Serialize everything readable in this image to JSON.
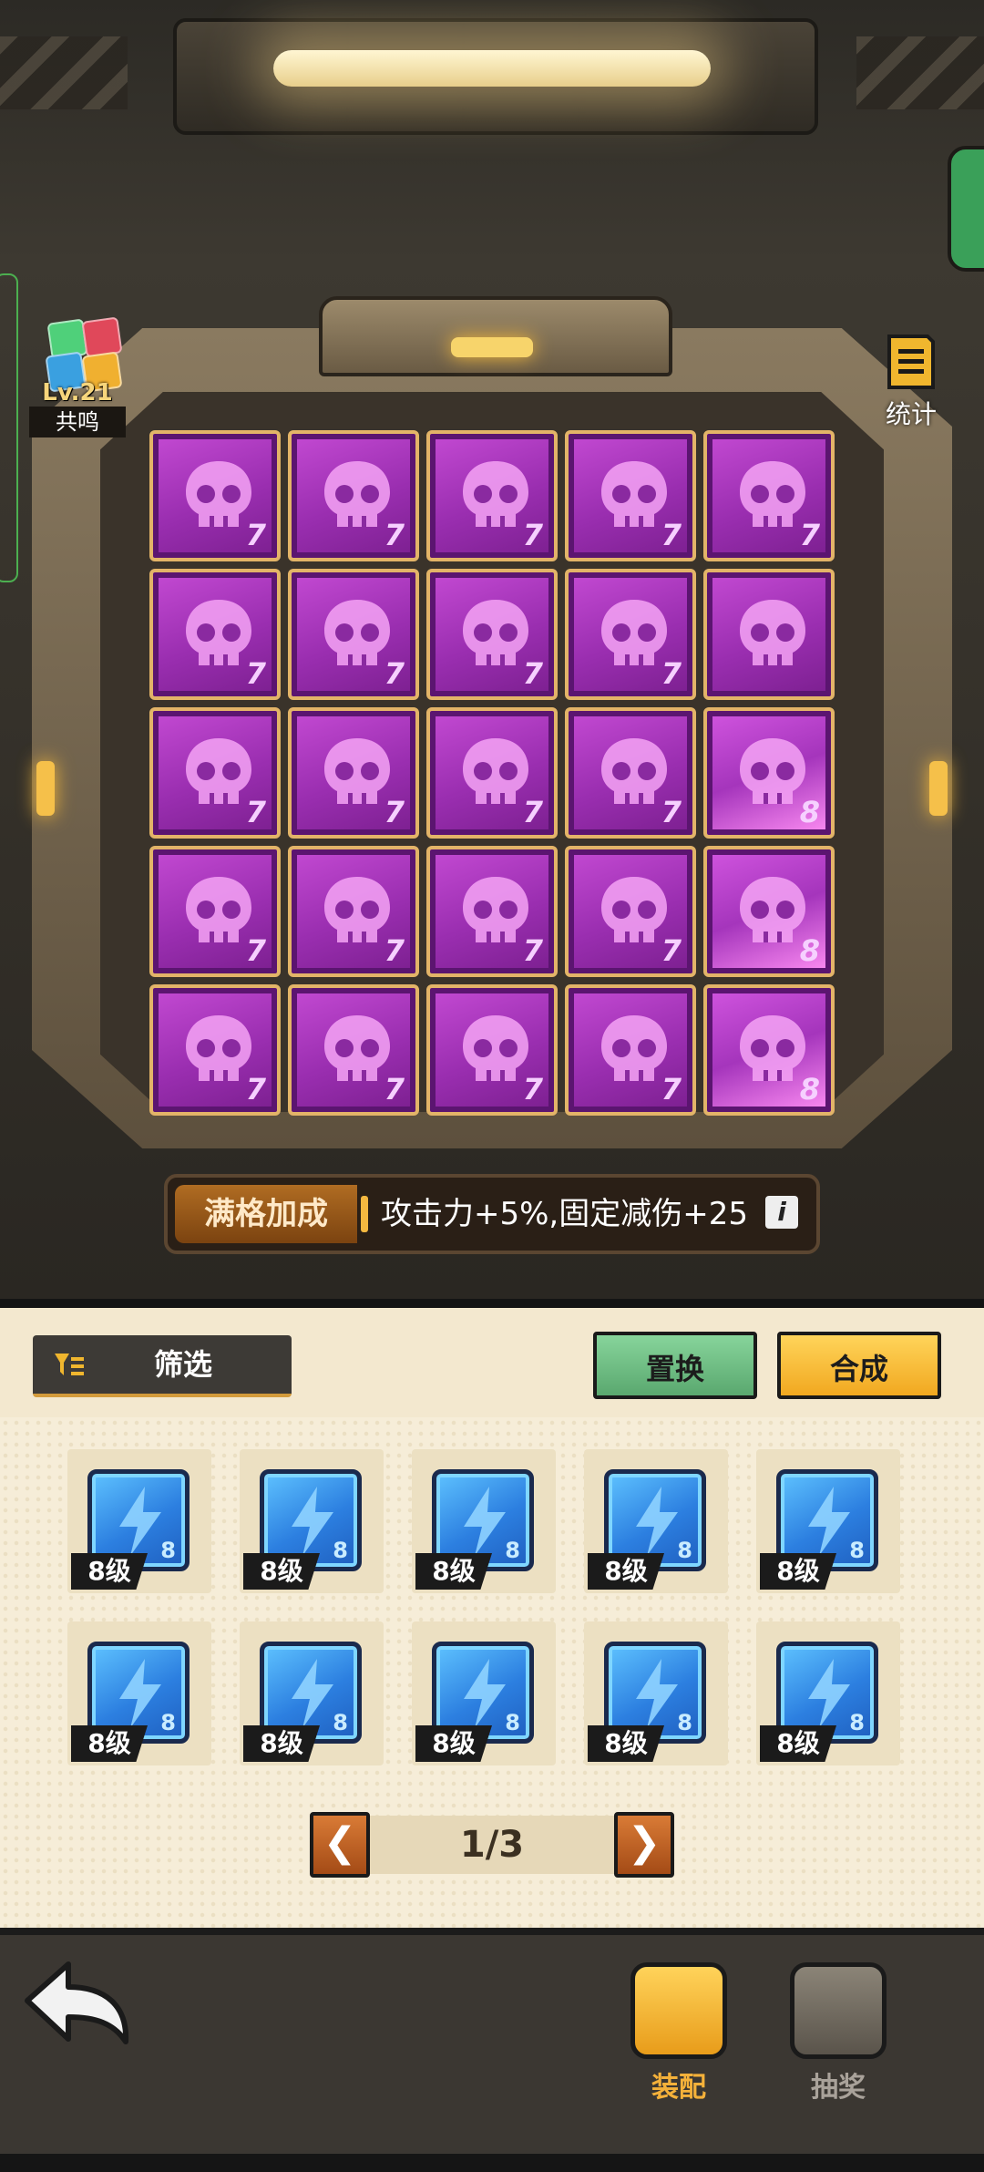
{
  "badge": {
    "level": "Lv.21",
    "label": "共鸣"
  },
  "stats": {
    "label": "统计"
  },
  "grid": {
    "rows": [
      [
        "7",
        "7",
        "7",
        "7",
        "7"
      ],
      [
        "7",
        "7",
        "7",
        "7",
        ""
      ],
      [
        "7",
        "7",
        "7",
        "7",
        "8"
      ],
      [
        "7",
        "7",
        "7",
        "7",
        "8"
      ],
      [
        "7",
        "7",
        "7",
        "7",
        "8"
      ]
    ]
  },
  "bonus": {
    "tag": "满格加成",
    "text": "攻击力+5%,固定减伤+25",
    "info": "i"
  },
  "toolbar": {
    "filter_label": "筛选",
    "swap_label": "置换",
    "merge_label": "合成"
  },
  "inventory": {
    "items": [
      {
        "level": "8",
        "label": "8级"
      },
      {
        "level": "8",
        "label": "8级"
      },
      {
        "level": "8",
        "label": "8级"
      },
      {
        "level": "8",
        "label": "8级"
      },
      {
        "level": "8",
        "label": "8级"
      },
      {
        "level": "8",
        "label": "8级"
      },
      {
        "level": "8",
        "label": "8级"
      },
      {
        "level": "8",
        "label": "8级"
      },
      {
        "level": "8",
        "label": "8级"
      },
      {
        "level": "8",
        "label": "8级"
      }
    ]
  },
  "pager": {
    "text": "1/3",
    "prev": "❮",
    "next": "❯"
  },
  "nav": {
    "equip_label": "装配",
    "draw_label": "抽奖"
  },
  "colors": {
    "accent": "#e3b468",
    "purple": "#a535bc",
    "blue": "#2c7fe0",
    "panel": "#f6edd8"
  }
}
